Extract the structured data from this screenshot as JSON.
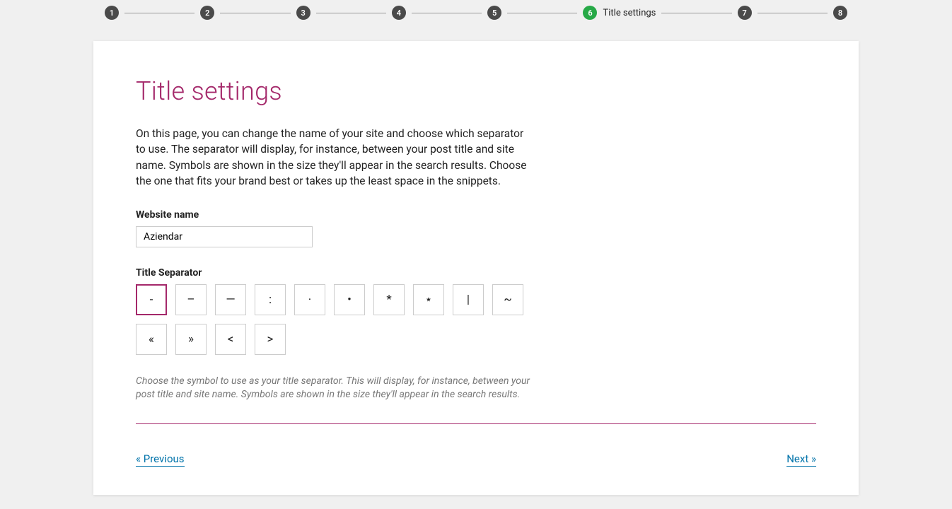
{
  "stepper": {
    "steps": [
      {
        "num": "1",
        "label": "",
        "active": false
      },
      {
        "num": "2",
        "label": "",
        "active": false
      },
      {
        "num": "3",
        "label": "",
        "active": false
      },
      {
        "num": "4",
        "label": "",
        "active": false
      },
      {
        "num": "5",
        "label": "",
        "active": false
      },
      {
        "num": "6",
        "label": "Title settings",
        "active": true
      },
      {
        "num": "7",
        "label": "",
        "active": false
      },
      {
        "num": "8",
        "label": "",
        "active": false
      }
    ]
  },
  "page": {
    "heading": "Title settings",
    "intro": "On this page, you can change the name of your site and choose which separator to use. The separator will display, for instance, between your post title and site name. Symbols are shown in the size they'll appear in the search results. Choose the one that fits your brand best or takes up the least space in the snippets."
  },
  "website_name": {
    "label": "Website name",
    "value": "Aziendar"
  },
  "title_separator": {
    "label": "Title Separator",
    "options": [
      {
        "glyph": "-",
        "selected": true
      },
      {
        "glyph": "–",
        "selected": false
      },
      {
        "glyph": "—",
        "selected": false
      },
      {
        "glyph": ":",
        "selected": false
      },
      {
        "glyph": "·",
        "selected": false
      },
      {
        "glyph": "•",
        "selected": false
      },
      {
        "glyph": "*",
        "selected": false
      },
      {
        "glyph": "⋆",
        "selected": false
      },
      {
        "glyph": "|",
        "selected": false
      },
      {
        "glyph": "~",
        "selected": false
      },
      {
        "glyph": "«",
        "selected": false
      },
      {
        "glyph": "»",
        "selected": false
      },
      {
        "glyph": "<",
        "selected": false
      },
      {
        "glyph": ">",
        "selected": false
      }
    ],
    "hint": "Choose the symbol to use as your title separator. This will display, for instance, between your post title and site name. Symbols are shown in the size they'll appear in the search results."
  },
  "nav": {
    "prev": "« Previous",
    "next": "Next »"
  }
}
